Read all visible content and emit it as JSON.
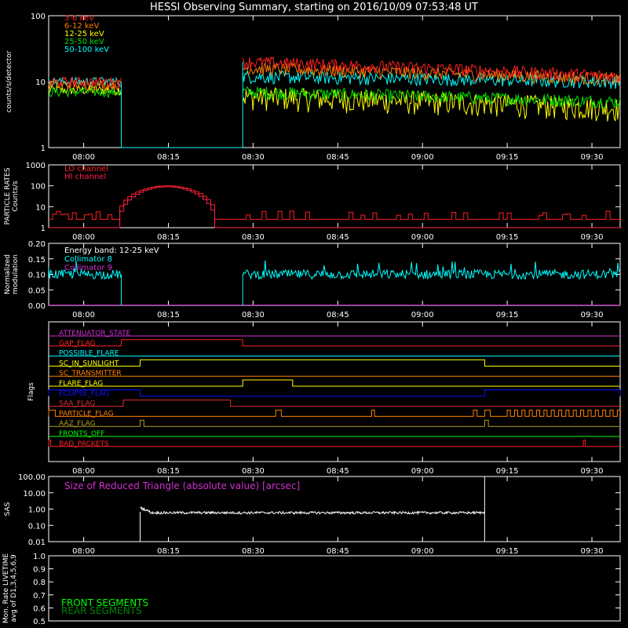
{
  "title": "HESSI Observing Summary, starting on 2016/10/09 07:53:48 UT",
  "colors": {
    "background": "#000000",
    "axes": "#ffffff",
    "red": "#ff2020",
    "orange": "#ff8000",
    "yellow": "#ffff00",
    "green": "#00e000",
    "cyan": "#00ffff",
    "magenta": "#d030d0",
    "blue": "#1010ff",
    "olive": "#b0a020",
    "lime": "#00ff00",
    "crimson": "#ff2050",
    "darkred": "#e03030"
  },
  "chart_data": [
    {
      "id": "count_rates",
      "type": "line",
      "ylabel": "counts/s/detector",
      "yscale": "log",
      "yticks": [
        "1",
        "10",
        "100"
      ],
      "ylim": [
        1,
        100
      ],
      "xlim": [
        "07:53:48",
        "09:35:00"
      ],
      "xticks": [
        "08:00",
        "08:15",
        "08:30",
        "08:45",
        "09:00",
        "09:15",
        "09:30"
      ],
      "data_gap": [
        "08:06:40",
        "08:28:10"
      ],
      "series": [
        {
          "name": "3-6 keV",
          "color": "#ff2020",
          "level_before": 10,
          "level_after": [
            20,
            12
          ]
        },
        {
          "name": "6-12 keV",
          "color": "#ff8000",
          "level_before": 9,
          "level_after": [
            16,
            11
          ]
        },
        {
          "name": "12-25 keV",
          "color": "#ffff00",
          "level_before": 7.5,
          "level_after": [
            6,
            4
          ]
        },
        {
          "name": "25-50 keV",
          "color": "#00e000",
          "level_before": 7,
          "level_after": [
            7,
            5
          ]
        },
        {
          "name": "50-100 keV",
          "color": "#00ffff",
          "level_before": 10,
          "level_after": [
            12,
            10
          ]
        }
      ]
    },
    {
      "id": "particle_rates",
      "type": "line",
      "ylabel": "PARTICLE RATES Counts/s",
      "yscale": "log",
      "yticks": [
        "1",
        "10",
        "100",
        "1000"
      ],
      "ylim": [
        1,
        1000
      ],
      "series": [
        {
          "name": "LO channel",
          "color": "#ff2020",
          "baseline": 2.5,
          "peak": 100
        },
        {
          "name": "HI channel",
          "color": "#ff2050",
          "baseline": 1,
          "peak": 90
        }
      ],
      "saa_peak": [
        "08:09:00",
        "08:20:00"
      ]
    },
    {
      "id": "modulation",
      "type": "line",
      "ylabel": "Normalized modulation",
      "yticks": [
        "0.00",
        "0.05",
        "0.10",
        "0.15",
        "0.20"
      ],
      "ylim": [
        0,
        0.2
      ],
      "annotation": "Energy band: 12-25 keV",
      "series": [
        {
          "name": "Collimator 8",
          "color": "#00ffff",
          "mean": 0.1
        },
        {
          "name": "Collimator 9",
          "color": "#d030d0",
          "mean": 0
        }
      ]
    },
    {
      "id": "flags",
      "type": "line",
      "ylabel": "Flags",
      "flags": [
        {
          "name": "ATTENUATOR_STATE",
          "color": "#d030d0"
        },
        {
          "name": "GAP_FLAG",
          "color": "#ff2020"
        },
        {
          "name": "POSSIBLE_FLARE",
          "color": "#00ffff"
        },
        {
          "name": "SC_IN_SUNLIGHT",
          "color": "#ffff00"
        },
        {
          "name": "SC_TRANSMITTER",
          "color": "#ff8000"
        },
        {
          "name": "FLARE_FLAG",
          "color": "#ffff00"
        },
        {
          "name": "ECLIPSE_FLAG",
          "color": "#1010ff"
        },
        {
          "name": "SAA_FLAG",
          "color": "#e03030"
        },
        {
          "name": "PARTICLE_FLAG",
          "color": "#ff8000"
        },
        {
          "name": "AAZ_FLAG",
          "color": "#b0a020"
        },
        {
          "name": "FRONTS_OFF",
          "color": "#00ff00"
        },
        {
          "name": "BAD_PACKETS",
          "color": "#ff2020"
        }
      ]
    },
    {
      "id": "sas",
      "type": "line",
      "ylabel": "SAS",
      "yscale": "log",
      "yticks": [
        "0.01",
        "0.10",
        "1.00",
        "10.00",
        "100.00"
      ],
      "ylim": [
        0.01,
        100
      ],
      "annotation": "Size of Reduced Triangle (absolute value) [arcsec]",
      "series": [
        {
          "name": "",
          "color": "#ffffff",
          "level": 0.6
        }
      ]
    },
    {
      "id": "livetime",
      "type": "line",
      "ylabel": "Mon. Rate LIVETIME avg of D1,3,4,5,6,9",
      "yticks": [
        "0.5",
        "0.6",
        "0.7",
        "0.8",
        "0.9",
        "1.0"
      ],
      "ylim": [
        0.5,
        1.0
      ],
      "series": [
        {
          "name": "FRONT SEGMENTS",
          "color": "#00ff00"
        },
        {
          "name": "REAR SEGMENTS",
          "color": "#008800"
        }
      ]
    }
  ]
}
